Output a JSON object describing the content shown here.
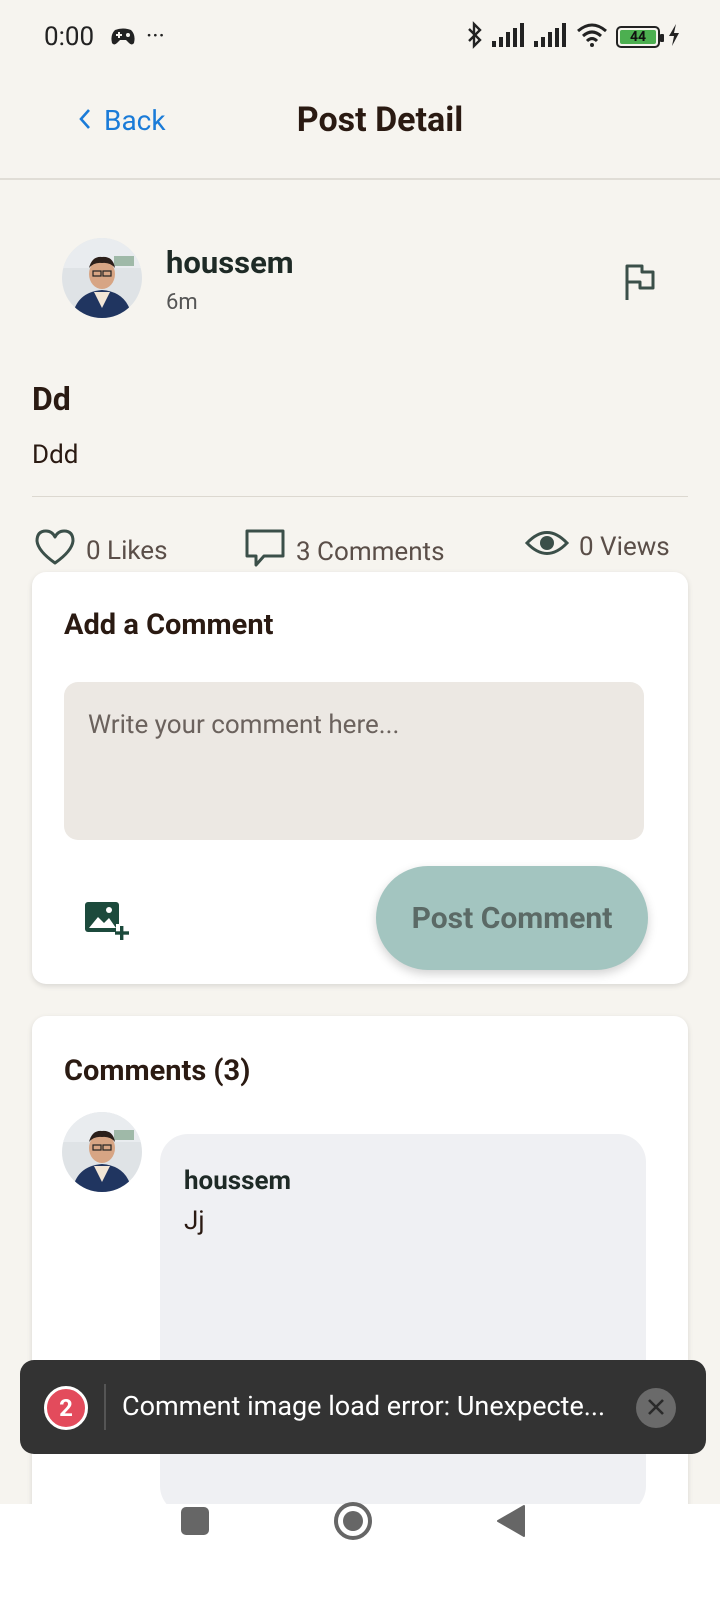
{
  "status_bar": {
    "time": "0:00",
    "dots": "···",
    "battery": "44",
    "icons": [
      "gamepad-icon",
      "bluetooth-icon",
      "signal-icon",
      "signal-icon",
      "wifi-icon",
      "battery-icon",
      "charging-icon"
    ]
  },
  "header": {
    "back_label": "Back",
    "title": "Post Detail"
  },
  "post": {
    "author": "houssem",
    "time": "6m",
    "title": "Dd",
    "body": "Ddd",
    "stats": {
      "likes": "0 Likes",
      "comments": "3 Comments",
      "views": "0 Views"
    }
  },
  "add_comment": {
    "title": "Add a Comment",
    "placeholder": "Write your comment here...",
    "post_button": "Post Comment"
  },
  "comments": {
    "title": "Comments (3)",
    "items": [
      {
        "author": "houssem",
        "text": "Jj"
      }
    ]
  },
  "toast": {
    "count": "2",
    "message": "Comment image load error: Unexpecte..."
  },
  "colors": {
    "background": "#f6f4ef",
    "link": "#1a7bd8",
    "post_button": "#a3c5c0",
    "toast": "#333333",
    "toast_badge": "#e34b5c"
  }
}
